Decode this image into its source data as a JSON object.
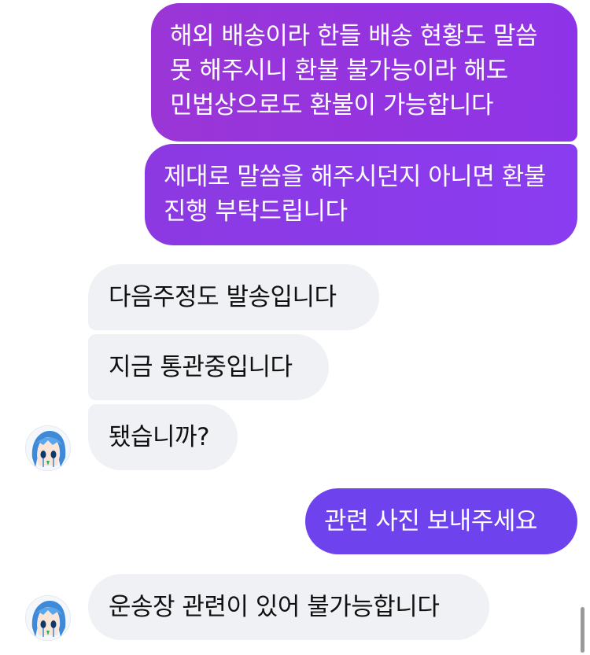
{
  "messages": [
    {
      "side": "outgoing",
      "text": "해외 배송이라 한들 배송 현황도 말씀 못 해주시니 환불 불가능이라 해도 민법상으로도 환불이 가능합니다"
    },
    {
      "side": "outgoing",
      "text": "제대로 말씀을 해주시던지 아니면 환불 진행 부탁드립니다"
    },
    {
      "side": "incoming",
      "text": "다음주정도 발송입니다"
    },
    {
      "side": "incoming",
      "text": "지금 통관중입니다"
    },
    {
      "side": "incoming",
      "text": "됐습니까?"
    },
    {
      "side": "outgoing",
      "text": "관련 사진 보내주세요"
    },
    {
      "side": "incoming",
      "text": "운송장 관련이 있어 불가능합니다"
    }
  ],
  "colors": {
    "outgoing_gradient_start": "#9b35d6",
    "outgoing_gradient_end": "#8a3cf0",
    "outgoing_solid": "#6e43ee",
    "incoming_bubble": "#eff1f4",
    "incoming_text": "#111111",
    "outgoing_text": "#ffffff"
  },
  "icons": {
    "sender_avatar": "anime-avatar-icon"
  }
}
